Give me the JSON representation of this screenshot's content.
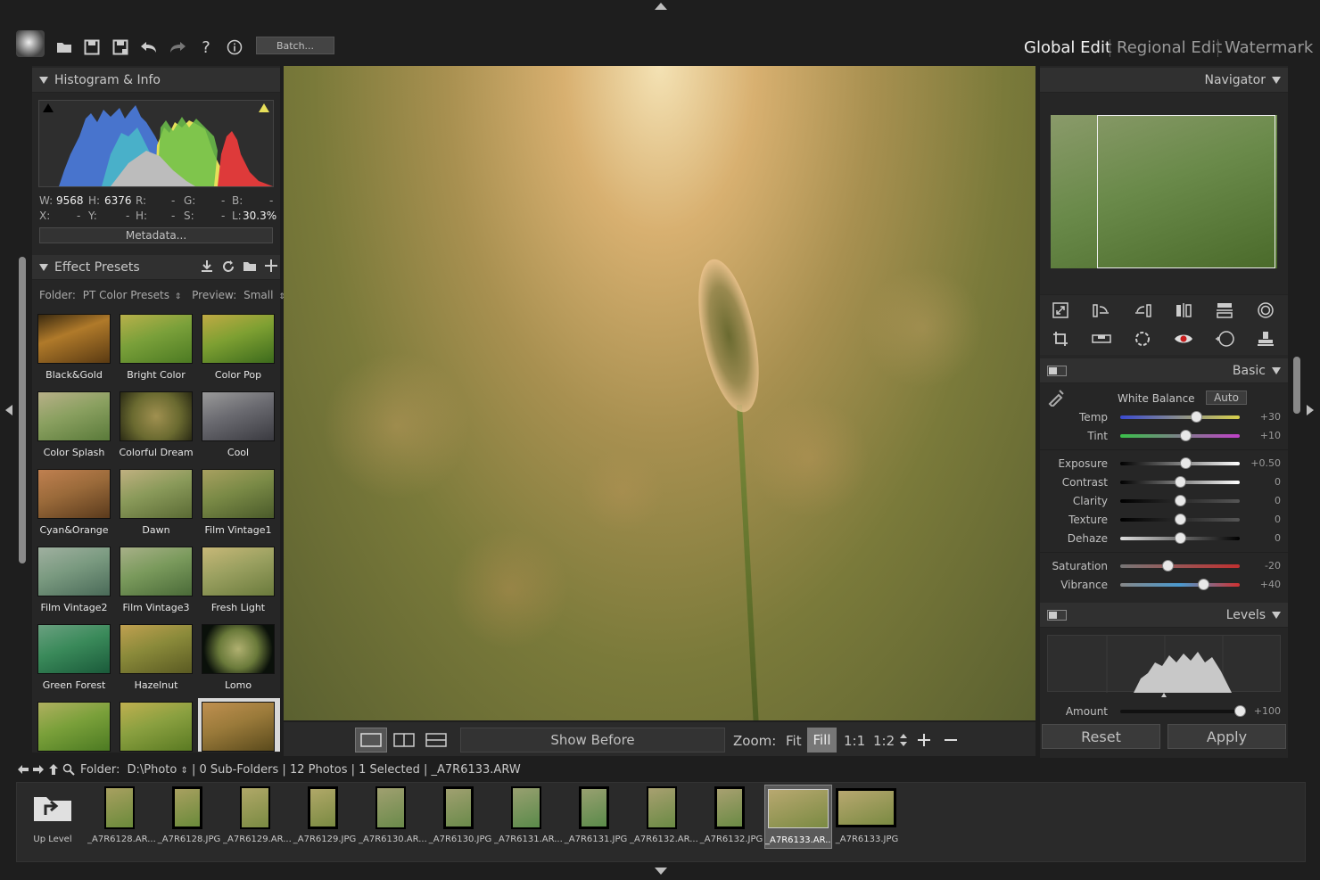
{
  "toolbar": {
    "batch_label": "Batch...",
    "tabs": [
      "Global Edit",
      "Regional Edit",
      "Watermark"
    ]
  },
  "histogram": {
    "title": "Histogram & Info",
    "w_label": "W:",
    "w_value": "9568",
    "h_label": "H:",
    "h_value": "6376",
    "r_label": "R:",
    "r_value": "-",
    "g_label": "G:",
    "g_value": "-",
    "b_label": "B:",
    "b_value": "-",
    "x_label": "X:",
    "x_value": "-",
    "y_label": "Y:",
    "y_value": "-",
    "hh_label": "H:",
    "hh_value": "-",
    "s_label": "S:",
    "s_value": "-",
    "l_label": "L:",
    "l_value": "30.3%",
    "metadata_button": "Metadata..."
  },
  "presets": {
    "title": "Effect Presets",
    "folder_label": "Folder:",
    "folder_value": "PT Color Presets",
    "preview_label": "Preview:",
    "preview_value": "Small",
    "items": [
      "Black&Gold",
      "Bright Color",
      "Color Pop",
      "Color Splash",
      "Colorful Dream",
      "Cool",
      "Cyan&Orange",
      "Dawn",
      "Film Vintage1",
      "Film Vintage2",
      "Film Vintage3",
      "Fresh Light",
      "Green Forest",
      "Hazelnut",
      "Lomo"
    ]
  },
  "viewer": {
    "show_before": "Show Before",
    "zoom_label": "Zoom:",
    "zoom_fit": "Fit",
    "zoom_fill": "Fill",
    "zoom_1_1": "1:1",
    "zoom_1_2": "1:2"
  },
  "navigator": {
    "title": "Navigator"
  },
  "basic": {
    "title": "Basic",
    "white_balance": "White Balance",
    "auto": "Auto",
    "sliders": [
      {
        "name": "Temp",
        "value": "+30",
        "pos": 0.64
      },
      {
        "name": "Tint",
        "value": "+10",
        "pos": 0.55
      },
      {
        "name": "Exposure",
        "value": "+0.50",
        "pos": 0.55
      },
      {
        "name": "Contrast",
        "value": "0",
        "pos": 0.5
      },
      {
        "name": "Clarity",
        "value": "0",
        "pos": 0.5
      },
      {
        "name": "Texture",
        "value": "0",
        "pos": 0.5
      },
      {
        "name": "Dehaze",
        "value": "0",
        "pos": 0.5
      },
      {
        "name": "Saturation",
        "value": "-20",
        "pos": 0.4
      },
      {
        "name": "Vibrance",
        "value": "+40",
        "pos": 0.7
      }
    ]
  },
  "levels": {
    "title": "Levels",
    "amount_label": "Amount",
    "amount_value": "+100",
    "amount_pos": 1.0
  },
  "actions": {
    "reset": "Reset",
    "apply": "Apply"
  },
  "status": {
    "folder_label": "Folder:",
    "folder_path": "D:\\Photo",
    "info": "| 0 Sub-Folders | 12 Photos | 1 Selected | _A7R6133.ARW"
  },
  "filmstrip": {
    "up_level": "Up Level",
    "files": [
      "_A7R6128.AR...",
      "_A7R6128.JPG",
      "_A7R6129.AR...",
      "_A7R6129.JPG",
      "_A7R6130.AR...",
      "_A7R6130.JPG",
      "_A7R6131.AR...",
      "_A7R6131.JPG",
      "_A7R6132.AR...",
      "_A7R6132.JPG",
      "_A7R6133.AR...",
      "_A7R6133.JPG"
    ],
    "selected_index": 10
  },
  "colors": {
    "bg": "#1e1e1e",
    "panel": "#2a2a2a",
    "header": "#303030",
    "text": "#c8c8c8"
  }
}
